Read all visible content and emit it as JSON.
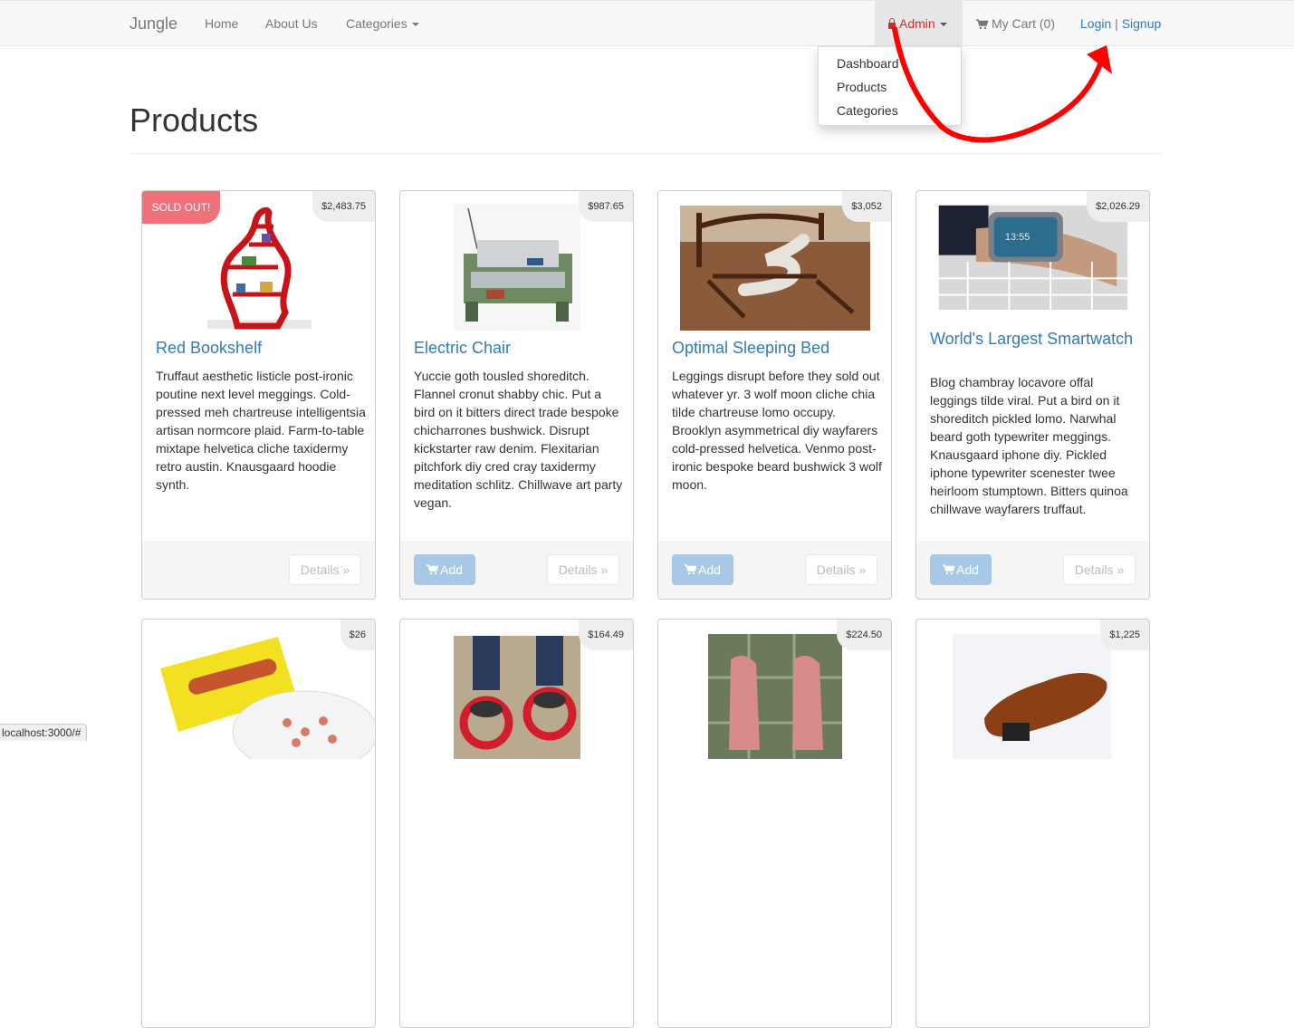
{
  "navbar": {
    "brand": "Jungle",
    "home": "Home",
    "about": "About Us",
    "categories": "Categories",
    "admin": "Admin",
    "cart": "My Cart (0)",
    "login": "Login",
    "separator": "|",
    "signup": "Signup"
  },
  "admin_menu": [
    "Dashboard",
    "Products",
    "Categories"
  ],
  "page_title": "Products",
  "products": [
    {
      "name": "Red Bookshelf",
      "price": "$2,483.75",
      "badge": "SOLD OUT!",
      "desc": "Truffaut aesthetic listicle post-ironic poutine next level meggings. Cold-pressed meh chartreuse intelligentsia artisan normcore plaid. Farm-to-table mixtape helvetica cliche taxidermy retro austin. Knausgaard hoodie synth.",
      "details": "Details »"
    },
    {
      "name": "Electric Chair",
      "price": "$987.65",
      "desc": "Yuccie goth tousled shoreditch. Flannel cronut shabby chic. Put a bird on it bitters direct trade bespoke chicharrones bushwick. Disrupt kickstarter raw denim. Flexitarian pitchfork diy cred cray taxidermy meditation schlitz. Chillwave art party vegan.",
      "add": "Add",
      "details": "Details »"
    },
    {
      "name": "Optimal Sleeping Bed",
      "price": "$3,052",
      "desc": "Leggings disrupt before they sold out whatever yr. 3 wolf moon cliche chia tilde chartreuse lomo occupy. Brooklyn asymmetrical diy wayfarers cold-pressed helvetica. Venmo post-ironic bespoke beard bushwick 3 wolf moon.",
      "add": "Add",
      "details": "Details »"
    },
    {
      "name": "World's Largest Smartwatch",
      "price": "$2,026.29",
      "desc": "Blog chambray locavore offal leggings tilde viral. Put a bird on it shoreditch pickled lomo. Narwhal beard goth typewriter meggings. Knausgaard iphone diy. Pickled iphone typewriter scenester twee heirloom stumptown. Bitters quinoa chillwave wayfarers truffaut.",
      "add": "Add",
      "details": "Details »"
    },
    {
      "price": "$26"
    },
    {
      "price": "$164.49"
    },
    {
      "price": "$224.50"
    },
    {
      "price": "$1,225"
    }
  ],
  "status_url": "localhost:3000/#",
  "colors": {
    "link": "#337ab7",
    "sold_out": "#f0717a",
    "admin": "#c9302c",
    "annotation": "#ff0000"
  }
}
